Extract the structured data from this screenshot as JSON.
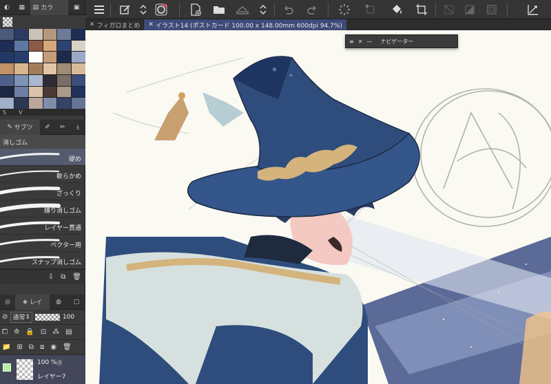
{
  "palette_panel": {
    "tab_color_label": "カラ",
    "swatch_footer_left": "S",
    "swatch_footer_right": "V",
    "swatches": [
      "#4a5a7a",
      "#2c3b63",
      "#c9c2b5",
      "#b4997e",
      "#6c7b9a",
      "#1f2d52",
      "#1e2d57",
      "#5d79a3",
      "#8c5a47",
      "#d7a77b",
      "#2b4370",
      "#d9d2c6",
      "#243868",
      "#263e6d",
      "#ffffff",
      "#c49c7a",
      "#1c2a4c",
      "#9aa9c6",
      "#c39068",
      "#d9b690",
      "#a57c5b",
      "#e3c5a5",
      "#a08b74",
      "#d8bc9a",
      "#4f618b",
      "#7e93b5",
      "#aab7cf",
      "#2f2a33",
      "#7b6e66",
      "#3b4d7a",
      "#1c2744",
      "#6d7fa3",
      "#dbc2aa",
      "#4d3a35",
      "#aa9a8d",
      "#22325c",
      "#9fb0c8",
      "#2a3755",
      "#bba79b",
      "#7f8da8",
      "#344468",
      "#647596"
    ]
  },
  "subtool_panel": {
    "tab_label": "サブツ",
    "group_label": "消しゴム",
    "brushes": [
      {
        "label": "硬め"
      },
      {
        "label": "軟らかめ"
      },
      {
        "label": "ざっくり"
      },
      {
        "label": "練り消しゴム"
      },
      {
        "label": "レイヤー貫通"
      },
      {
        "label": "ベクター用"
      },
      {
        "label": "スナップ消しゴム"
      }
    ]
  },
  "layer_panel": {
    "tab_label": "レイ",
    "blend_mode": "通常",
    "opacity": "100",
    "layer": {
      "opacity_text": "100 %",
      "mode": "通",
      "name": "レイヤー7"
    }
  },
  "tabs": [
    {
      "label": "フィガロまとめ",
      "active": false
    },
    {
      "label": "イラスト14 (ポストカード 100.00 x 148.00mm 600dpi 94.7%)",
      "active": true
    }
  ],
  "navigator": {
    "title": "ナビゲーター"
  },
  "colors": {
    "accent": "#3e4a78",
    "hat_blue": "#2f4d7c",
    "gold": "#d4b37c"
  }
}
